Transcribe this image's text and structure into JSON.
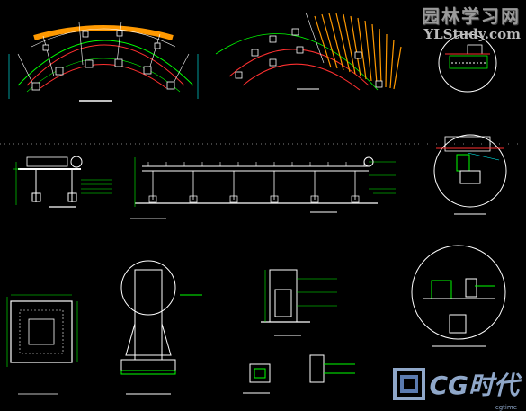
{
  "watermark_top": {
    "chinese": "园林学习网",
    "url": "YLStudy.com"
  },
  "watermark_bottom": {
    "brand": "CG时代",
    "sub": "cgtime"
  },
  "labels": {
    "plan_left": "",
    "plan_right": "",
    "elevation": "",
    "detail_left": "",
    "detail_mid": "",
    "detail_right": ""
  },
  "colors": {
    "background": "#000000",
    "line_green": "#00ff00",
    "line_white": "#ffffff",
    "line_red": "#ff2020",
    "fill_orange": "#ff9900",
    "line_cyan": "#00ffff",
    "line_yellow": "#ffff00"
  }
}
